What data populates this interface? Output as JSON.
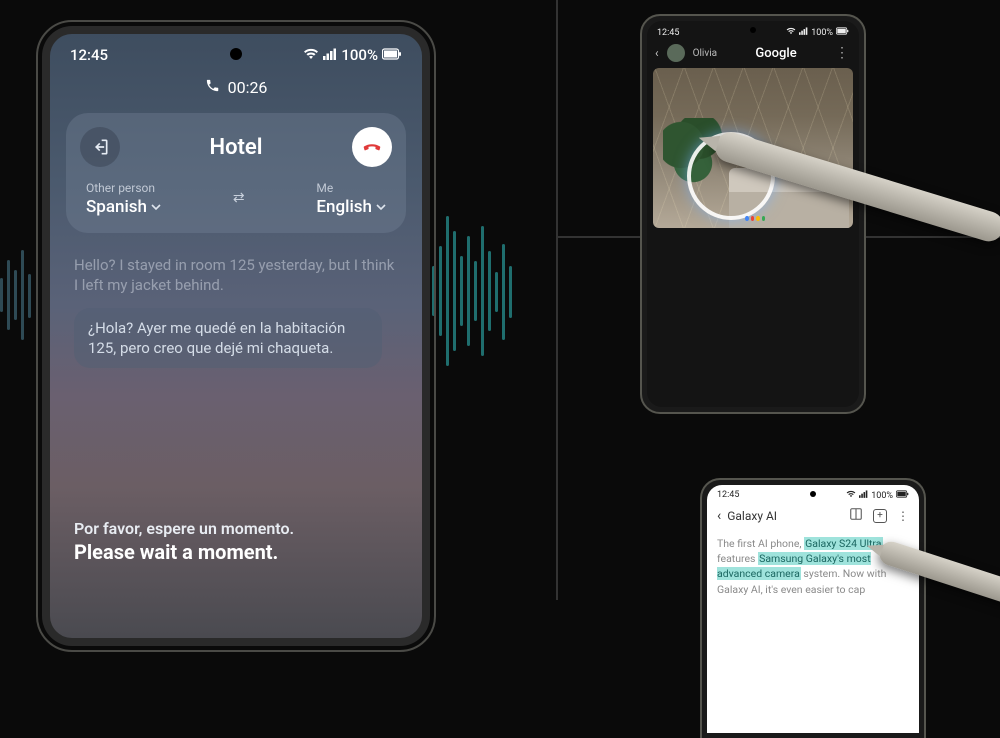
{
  "left_phone": {
    "status": {
      "time": "12:45",
      "battery": "100%"
    },
    "call_timer": "00:26",
    "card": {
      "title": "Hotel",
      "other_label": "Other person",
      "other_lang": "Spanish",
      "me_label": "Me",
      "me_lang": "English"
    },
    "transcript": {
      "faded": "Hello? I stayed in room 125 yesterday, but I think I left my jacket behind.",
      "bubble": "¿Hola? Ayer me quedé en la habitación 125, pero creo que dejé mi chaqueta."
    },
    "bottom": {
      "a": "Por favor, espere un momento.",
      "b": "Please wait a moment."
    }
  },
  "tr_phone": {
    "status": {
      "time": "12:45",
      "battery": "100%"
    },
    "back_name": "Olivia",
    "brand": "Google"
  },
  "br_phone": {
    "status": {
      "time": "12:45",
      "battery": "100%"
    },
    "page_title": "Galaxy AI",
    "body_prefix": "The first AI phone, ",
    "body_h1": "Galaxy S24 Ultra",
    "body_mid1": " features ",
    "body_h2": "Samsung Galaxy's most advanced camera",
    "body_mid2": " system. Now with Galaxy AI, it's even easier to cap"
  }
}
